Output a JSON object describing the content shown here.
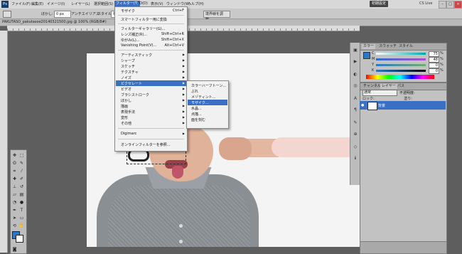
{
  "menubar": {
    "logo": "Ps",
    "items": [
      "ファイル(F)",
      "編集(E)",
      "イメージ(I)",
      "レイヤー(L)",
      "選択範囲(S)",
      "フィルター(T)",
      "3D(D)",
      "表示(V)",
      "ウィンドウ(W)",
      "ヘルプ(H)"
    ],
    "workspace": "初期設定",
    "cslive": "CS Live",
    "window_buttons": [
      "–",
      "□",
      "×"
    ]
  },
  "optbar": {
    "feather_label": "ぼかし:",
    "feather_value": "0 px",
    "antialias_label": "アンチエイリアス",
    "style_label": "スタイル:",
    "style_value": "標",
    "refine_button": "境界線を調整..."
  },
  "doc": {
    "title": "PAKUTASO_pakutasoe20140321500.jpg @ 100% (RGB/8#)"
  },
  "filter_menu": {
    "last_filter": "モザイク",
    "last_filter_key": "Ctrl+F",
    "smart": "スマートフィルター用に変換",
    "gallery": "フィルターギャラリー(G)...",
    "lens": "レンズ補正(R)...",
    "lens_key": "Shift+Ctrl+R",
    "liquify": "ゆがみ(L)...",
    "liquify_key": "Shift+Ctrl+X",
    "vanishing": "Vanishing Point(V)...",
    "vanishing_key": "Alt+Ctrl+V",
    "artistic": "アーティスティック",
    "sharpen": "シャープ",
    "sketch": "スケッチ",
    "texture": "テクスチャ",
    "noise": "ノイズ",
    "pixelate": "ピクセレート",
    "video": "ビデオ",
    "brush": "ブラシストローク",
    "blur": "ぼかし",
    "render": "描画",
    "stylize": "表現手法",
    "distort": "変形",
    "other": "その他",
    "digimarc": "Digimarc",
    "browse": "オンラインフィルターを参照..."
  },
  "pixelate_submenu": {
    "items": [
      "カラーハーフトーン...",
      "ぶれ",
      "メゾティント...",
      "モザイク...",
      "水晶...",
      "点描...",
      "面を刻む"
    ],
    "highlighted": "モザイク..."
  },
  "color_panel": {
    "tabs": [
      "カラー",
      "スウォッチ",
      "スタイル"
    ],
    "sliders": [
      {
        "label": "C",
        "value": "75"
      },
      {
        "label": "M",
        "value": "48"
      },
      {
        "label": "Y",
        "value": "0"
      },
      {
        "label": "K",
        "value": "0"
      }
    ],
    "pct": "%",
    "swatch_color": "#2a78c9"
  },
  "layers_panel": {
    "tabs": [
      "チャンネル",
      "レイヤー",
      "パス"
    ],
    "blend_mode": "通常",
    "opacity_label": "不透明度:",
    "lock_label": "ロック:",
    "fill_label": "塗り:",
    "layer_name": "背景"
  }
}
